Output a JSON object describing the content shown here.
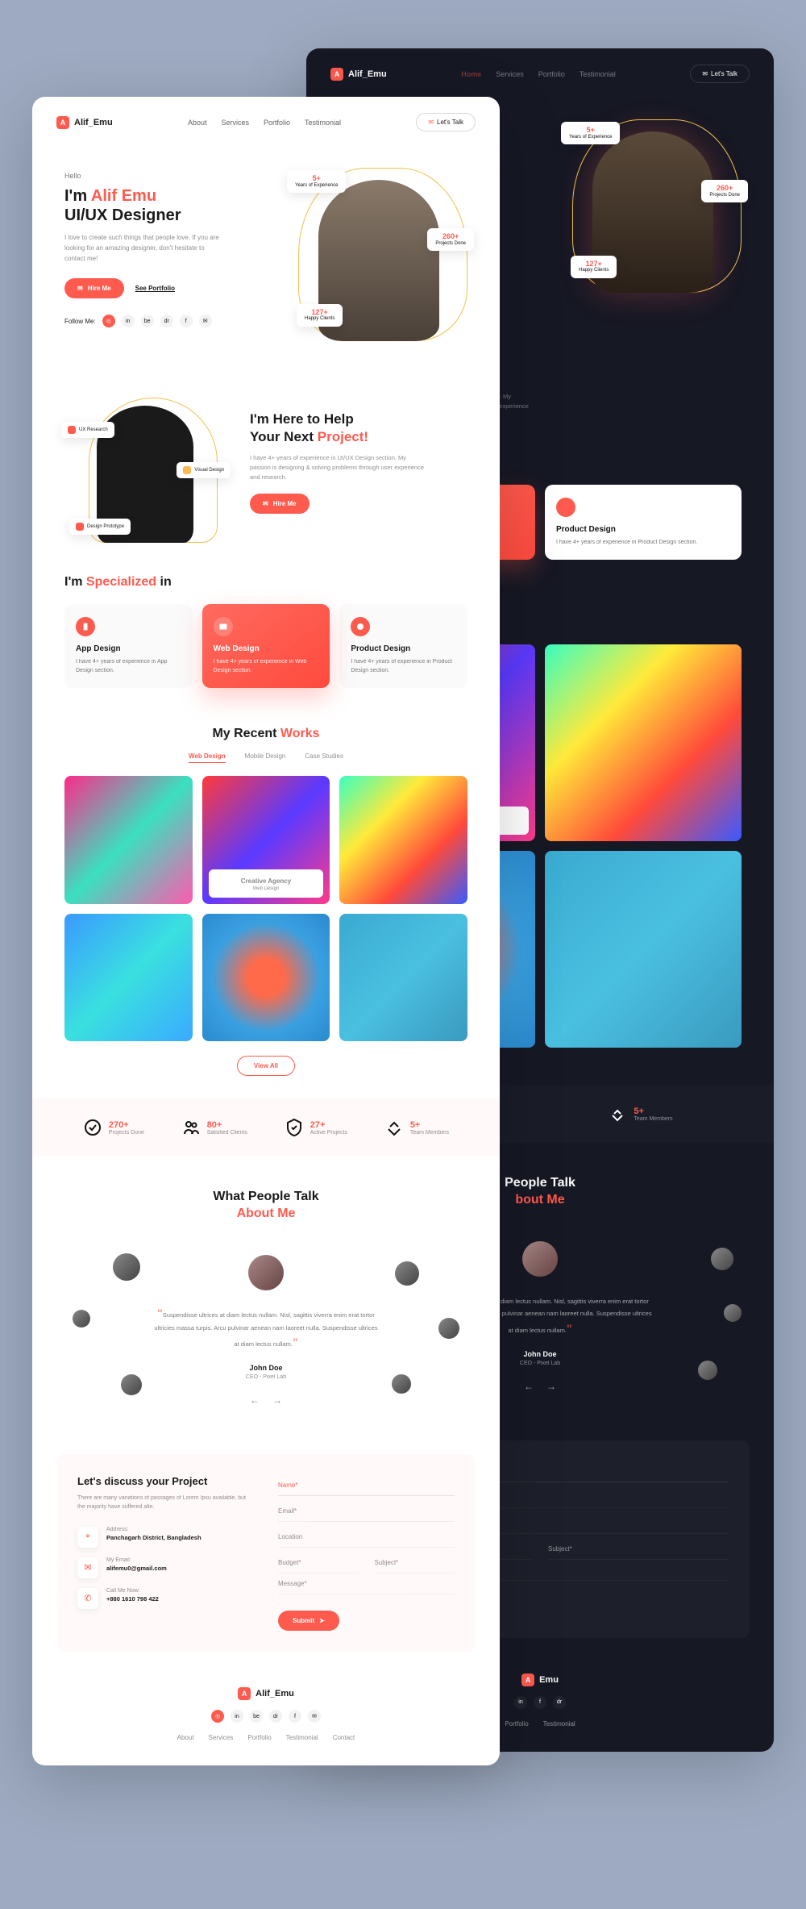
{
  "brand": "Alif_Emu",
  "nav": {
    "items": [
      "About",
      "Services",
      "Portfolio",
      "Testimonial"
    ],
    "itemsDark": [
      "Home",
      "Services",
      "Portfolio",
      "Testimonial"
    ],
    "cta": "Let's Talk"
  },
  "hero": {
    "greeting": "Hello",
    "titleA": "I'm ",
    "titleName": "Alif Emu",
    "titleB": "UI/UX Designer",
    "desc": "I love to create such things that people love. If you are looking for an amazing designer, don't hesitate to contact me!",
    "hire": "Hire Me",
    "portfolio": "See Portfolio",
    "follow": "Follow Me:",
    "socials": [
      "◎",
      "in",
      "be",
      "dr",
      "f",
      "✉"
    ],
    "stats": {
      "s1n": "5+",
      "s1l": "Years of Experience",
      "s2n": "260+",
      "s2l": "Projects Done",
      "s3n": "127+",
      "s3l": "Happy Clients"
    }
  },
  "help": {
    "titleA": "I'm Here to Help",
    "titleB": "Your Next ",
    "titleC": "Project!",
    "desc": "I have 4+ years of experience in UI/UX Design section. My passion is designing & solving problems through user experience and research.",
    "cta": "Hire Me",
    "chips": {
      "c1": "UX Research",
      "c2": "Visual Design",
      "c3": "Design Prototype"
    }
  },
  "spec": {
    "titleA": "I'm ",
    "titleB": "Specialized",
    "titleC": " in",
    "cards": [
      {
        "title": "App Design",
        "desc": "I have 4+ years of experience in App Design section."
      },
      {
        "title": "Web Design",
        "desc": "I have 4+ years of experience in Web Design section."
      },
      {
        "title": "Product Design",
        "desc": "I have 4+ years of experience in Product Design section."
      }
    ]
  },
  "works": {
    "titleA": "My Recent ",
    "titleB": "Works",
    "tabs": [
      "Web Design",
      "Mobile Design",
      "Case Studies"
    ],
    "overlayTitle": "Creative Agency",
    "overlaySub": "Web Design",
    "viewAll": "View All"
  },
  "stats": [
    {
      "n": "270+",
      "l": "Projects Done"
    },
    {
      "n": "80+",
      "l": "Satisfied Clients"
    },
    {
      "n": "27+",
      "l": "Active Projects"
    },
    {
      "n": "5+",
      "l": "Team Members"
    }
  ],
  "testi": {
    "titleA": "What People Talk",
    "titleB": "About Me",
    "quote": "Suspendisse ultrices at diam lectus nullam. Nisl, sagittis viverra enim erat tortor ultricies massa turpis. Arcu pulvinar aenean nam laoreet nulla. Suspendisse ultrices at diam lectus nullam.",
    "author": "John Doe",
    "role": "CEO - Pixel Lab"
  },
  "contact": {
    "title": "Let's discuss your Project",
    "desc": "There are many variations of passages of Lorem Ipsu available, but the majority have suffered alte.",
    "info": [
      {
        "l": "Address:",
        "v": "Panchagarh District, Bangladesh"
      },
      {
        "l": "My Email:",
        "v": "alifemu0@gmail.com"
      },
      {
        "l": "Call Me Now:",
        "v": "+880 1610 798 422"
      }
    ],
    "fields": {
      "name": "Name*",
      "email": "Email*",
      "location": "Location",
      "budget": "Budget*",
      "subject": "Subject*",
      "message": "Message*"
    },
    "submit": "Submit"
  },
  "footer": {
    "links": [
      "About",
      "Services",
      "Portfolio",
      "Testimonial",
      "Contact"
    ]
  }
}
